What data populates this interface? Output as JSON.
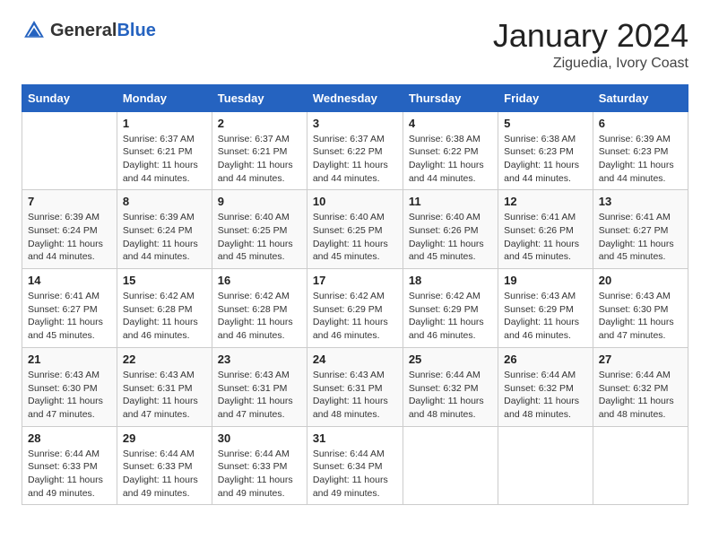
{
  "header": {
    "logo_general": "General",
    "logo_blue": "Blue",
    "title": "January 2024",
    "location": "Ziguedia, Ivory Coast"
  },
  "days_of_week": [
    "Sunday",
    "Monday",
    "Tuesday",
    "Wednesday",
    "Thursday",
    "Friday",
    "Saturday"
  ],
  "weeks": [
    [
      {
        "day": "",
        "sunrise": "",
        "sunset": "",
        "daylight": ""
      },
      {
        "day": "1",
        "sunrise": "Sunrise: 6:37 AM",
        "sunset": "Sunset: 6:21 PM",
        "daylight": "Daylight: 11 hours and 44 minutes."
      },
      {
        "day": "2",
        "sunrise": "Sunrise: 6:37 AM",
        "sunset": "Sunset: 6:21 PM",
        "daylight": "Daylight: 11 hours and 44 minutes."
      },
      {
        "day": "3",
        "sunrise": "Sunrise: 6:37 AM",
        "sunset": "Sunset: 6:22 PM",
        "daylight": "Daylight: 11 hours and 44 minutes."
      },
      {
        "day": "4",
        "sunrise": "Sunrise: 6:38 AM",
        "sunset": "Sunset: 6:22 PM",
        "daylight": "Daylight: 11 hours and 44 minutes."
      },
      {
        "day": "5",
        "sunrise": "Sunrise: 6:38 AM",
        "sunset": "Sunset: 6:23 PM",
        "daylight": "Daylight: 11 hours and 44 minutes."
      },
      {
        "day": "6",
        "sunrise": "Sunrise: 6:39 AM",
        "sunset": "Sunset: 6:23 PM",
        "daylight": "Daylight: 11 hours and 44 minutes."
      }
    ],
    [
      {
        "day": "7",
        "sunrise": "Sunrise: 6:39 AM",
        "sunset": "Sunset: 6:24 PM",
        "daylight": "Daylight: 11 hours and 44 minutes."
      },
      {
        "day": "8",
        "sunrise": "Sunrise: 6:39 AM",
        "sunset": "Sunset: 6:24 PM",
        "daylight": "Daylight: 11 hours and 44 minutes."
      },
      {
        "day": "9",
        "sunrise": "Sunrise: 6:40 AM",
        "sunset": "Sunset: 6:25 PM",
        "daylight": "Daylight: 11 hours and 45 minutes."
      },
      {
        "day": "10",
        "sunrise": "Sunrise: 6:40 AM",
        "sunset": "Sunset: 6:25 PM",
        "daylight": "Daylight: 11 hours and 45 minutes."
      },
      {
        "day": "11",
        "sunrise": "Sunrise: 6:40 AM",
        "sunset": "Sunset: 6:26 PM",
        "daylight": "Daylight: 11 hours and 45 minutes."
      },
      {
        "day": "12",
        "sunrise": "Sunrise: 6:41 AM",
        "sunset": "Sunset: 6:26 PM",
        "daylight": "Daylight: 11 hours and 45 minutes."
      },
      {
        "day": "13",
        "sunrise": "Sunrise: 6:41 AM",
        "sunset": "Sunset: 6:27 PM",
        "daylight": "Daylight: 11 hours and 45 minutes."
      }
    ],
    [
      {
        "day": "14",
        "sunrise": "Sunrise: 6:41 AM",
        "sunset": "Sunset: 6:27 PM",
        "daylight": "Daylight: 11 hours and 45 minutes."
      },
      {
        "day": "15",
        "sunrise": "Sunrise: 6:42 AM",
        "sunset": "Sunset: 6:28 PM",
        "daylight": "Daylight: 11 hours and 46 minutes."
      },
      {
        "day": "16",
        "sunrise": "Sunrise: 6:42 AM",
        "sunset": "Sunset: 6:28 PM",
        "daylight": "Daylight: 11 hours and 46 minutes."
      },
      {
        "day": "17",
        "sunrise": "Sunrise: 6:42 AM",
        "sunset": "Sunset: 6:29 PM",
        "daylight": "Daylight: 11 hours and 46 minutes."
      },
      {
        "day": "18",
        "sunrise": "Sunrise: 6:42 AM",
        "sunset": "Sunset: 6:29 PM",
        "daylight": "Daylight: 11 hours and 46 minutes."
      },
      {
        "day": "19",
        "sunrise": "Sunrise: 6:43 AM",
        "sunset": "Sunset: 6:29 PM",
        "daylight": "Daylight: 11 hours and 46 minutes."
      },
      {
        "day": "20",
        "sunrise": "Sunrise: 6:43 AM",
        "sunset": "Sunset: 6:30 PM",
        "daylight": "Daylight: 11 hours and 47 minutes."
      }
    ],
    [
      {
        "day": "21",
        "sunrise": "Sunrise: 6:43 AM",
        "sunset": "Sunset: 6:30 PM",
        "daylight": "Daylight: 11 hours and 47 minutes."
      },
      {
        "day": "22",
        "sunrise": "Sunrise: 6:43 AM",
        "sunset": "Sunset: 6:31 PM",
        "daylight": "Daylight: 11 hours and 47 minutes."
      },
      {
        "day": "23",
        "sunrise": "Sunrise: 6:43 AM",
        "sunset": "Sunset: 6:31 PM",
        "daylight": "Daylight: 11 hours and 47 minutes."
      },
      {
        "day": "24",
        "sunrise": "Sunrise: 6:43 AM",
        "sunset": "Sunset: 6:31 PM",
        "daylight": "Daylight: 11 hours and 48 minutes."
      },
      {
        "day": "25",
        "sunrise": "Sunrise: 6:44 AM",
        "sunset": "Sunset: 6:32 PM",
        "daylight": "Daylight: 11 hours and 48 minutes."
      },
      {
        "day": "26",
        "sunrise": "Sunrise: 6:44 AM",
        "sunset": "Sunset: 6:32 PM",
        "daylight": "Daylight: 11 hours and 48 minutes."
      },
      {
        "day": "27",
        "sunrise": "Sunrise: 6:44 AM",
        "sunset": "Sunset: 6:32 PM",
        "daylight": "Daylight: 11 hours and 48 minutes."
      }
    ],
    [
      {
        "day": "28",
        "sunrise": "Sunrise: 6:44 AM",
        "sunset": "Sunset: 6:33 PM",
        "daylight": "Daylight: 11 hours and 49 minutes."
      },
      {
        "day": "29",
        "sunrise": "Sunrise: 6:44 AM",
        "sunset": "Sunset: 6:33 PM",
        "daylight": "Daylight: 11 hours and 49 minutes."
      },
      {
        "day": "30",
        "sunrise": "Sunrise: 6:44 AM",
        "sunset": "Sunset: 6:33 PM",
        "daylight": "Daylight: 11 hours and 49 minutes."
      },
      {
        "day": "31",
        "sunrise": "Sunrise: 6:44 AM",
        "sunset": "Sunset: 6:34 PM",
        "daylight": "Daylight: 11 hours and 49 minutes."
      },
      {
        "day": "",
        "sunrise": "",
        "sunset": "",
        "daylight": ""
      },
      {
        "day": "",
        "sunrise": "",
        "sunset": "",
        "daylight": ""
      },
      {
        "day": "",
        "sunrise": "",
        "sunset": "",
        "daylight": ""
      }
    ]
  ]
}
